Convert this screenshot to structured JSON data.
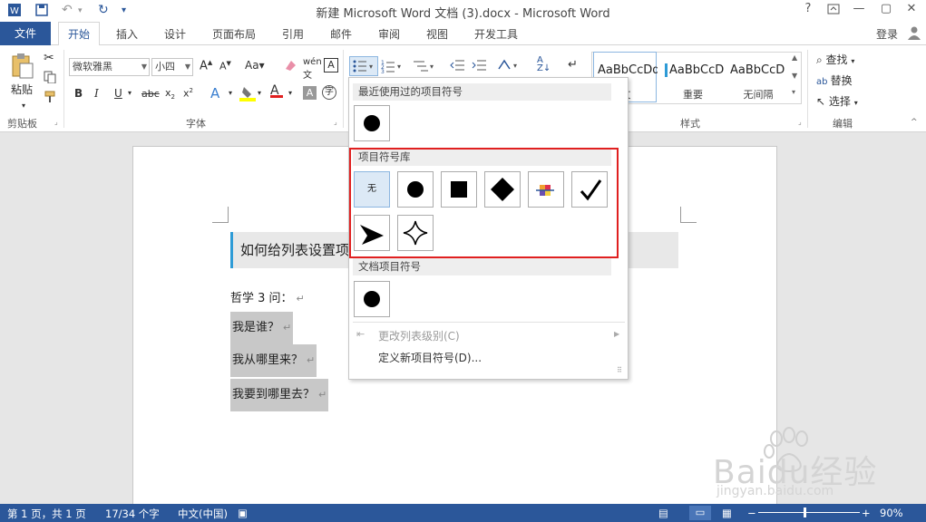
{
  "titlebar": {
    "title": "新建 Microsoft Word 文档 (3).docx - Microsoft Word",
    "help": "?",
    "minimize": "—",
    "restore": "▢",
    "close": "✕"
  },
  "tabs": {
    "file": "文件",
    "home": "开始",
    "insert": "插入",
    "design": "设计",
    "layout": "页面布局",
    "references": "引用",
    "mailings": "邮件",
    "review": "审阅",
    "view": "视图",
    "developer": "开发工具",
    "login": "登录"
  },
  "ribbon": {
    "paste": "粘贴",
    "clipboard": "剪贴板",
    "font_name": "微软雅黑",
    "font_size": "小四",
    "font_group": "字体",
    "styles_group": "样式",
    "editing_group": "编辑",
    "find": "查找",
    "replace": "替换",
    "select": "选择",
    "styles": [
      {
        "sample": "AaBbCcDd",
        "name": "文"
      },
      {
        "sample": "AaBbCcD",
        "name": "重要"
      },
      {
        "sample": "AaBbCcD",
        "name": "无间隔"
      }
    ]
  },
  "dropdown": {
    "recent_header": "最近使用过的项目符号",
    "library_header": "项目符号库",
    "none_label": "无",
    "doc_header": "文档项目符号",
    "change_level": "更改列表级别(C)",
    "define_new": "定义新项目符号(D)..."
  },
  "document": {
    "heading": "如何给列表设置项",
    "lines": [
      "哲学 3 问：",
      "我是谁？",
      "我从哪里来？",
      "我要到哪里去？"
    ]
  },
  "statusbar": {
    "page": "第 1 页，共 1 页",
    "words": "17/34 个字",
    "lang": "中文(中国)",
    "zoom": "90%"
  },
  "watermark": {
    "brand": "Baidu经验",
    "url": "jingyan.baidu.com"
  }
}
